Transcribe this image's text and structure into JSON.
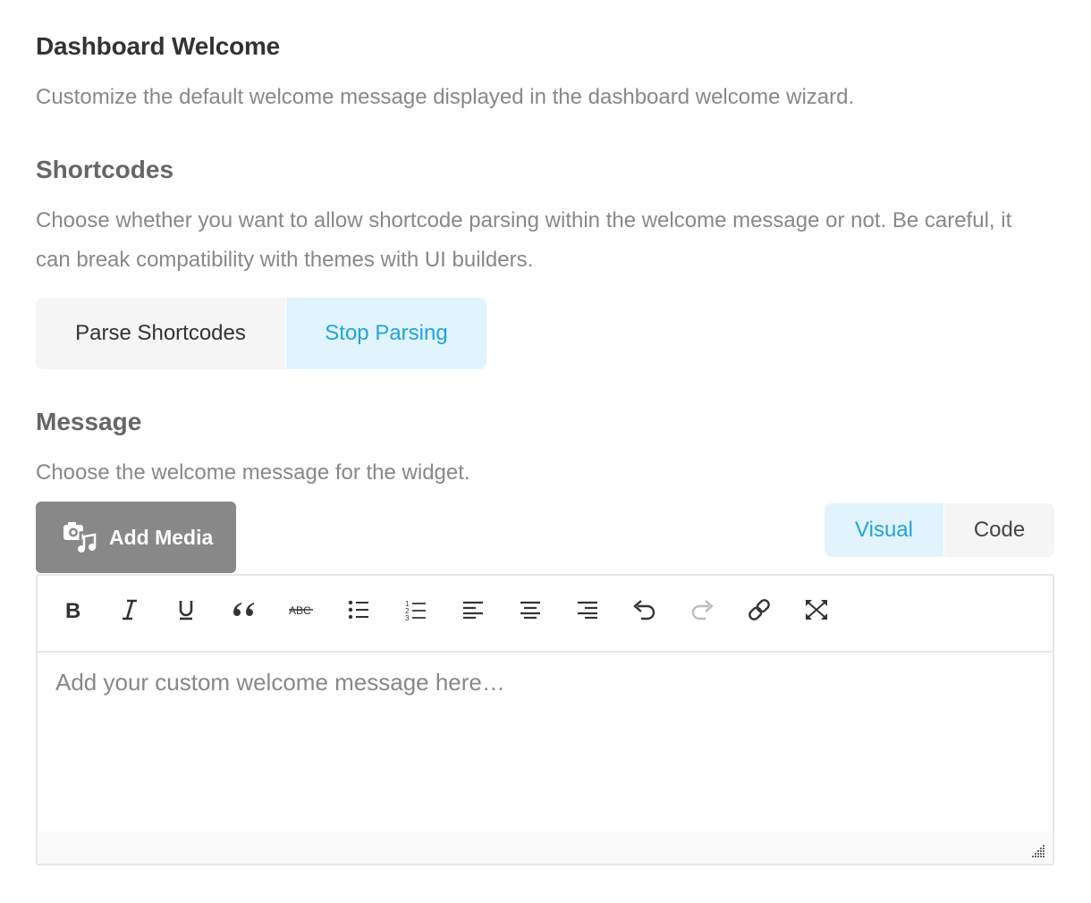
{
  "header": {
    "title": "Dashboard Welcome",
    "description": "Customize the default welcome message displayed in the dashboard welcome wizard."
  },
  "shortcodes": {
    "title": "Shortcodes",
    "description_line1": "Choose whether you want to allow shortcode parsing within the welcome message or not. Be careful, it",
    "description_line2": "can break compatibility with themes with UI builders.",
    "options": [
      "Parse Shortcodes",
      "Stop Parsing"
    ],
    "selected": "Stop Parsing"
  },
  "message": {
    "title": "Message",
    "description": "Choose the welcome message for the widget.",
    "add_media_label": "Add Media",
    "tabs": {
      "visual": "Visual",
      "code": "Code"
    },
    "active_tab": "Visual",
    "placeholder": "Add your custom welcome message here…",
    "toolbar_icons": [
      "bold-icon",
      "italic-icon",
      "underline-icon",
      "blockquote-icon",
      "strikethrough-icon",
      "bullet-list-icon",
      "numbered-list-icon",
      "align-left-icon",
      "align-center-icon",
      "align-right-icon",
      "undo-icon",
      "redo-icon",
      "link-icon",
      "fullscreen-icon"
    ]
  },
  "colors": {
    "accent": "#21a3dc",
    "accent_bg": "#e1f4fd",
    "button_gray": "#888888",
    "inactive_bg": "#f5f5f5"
  }
}
